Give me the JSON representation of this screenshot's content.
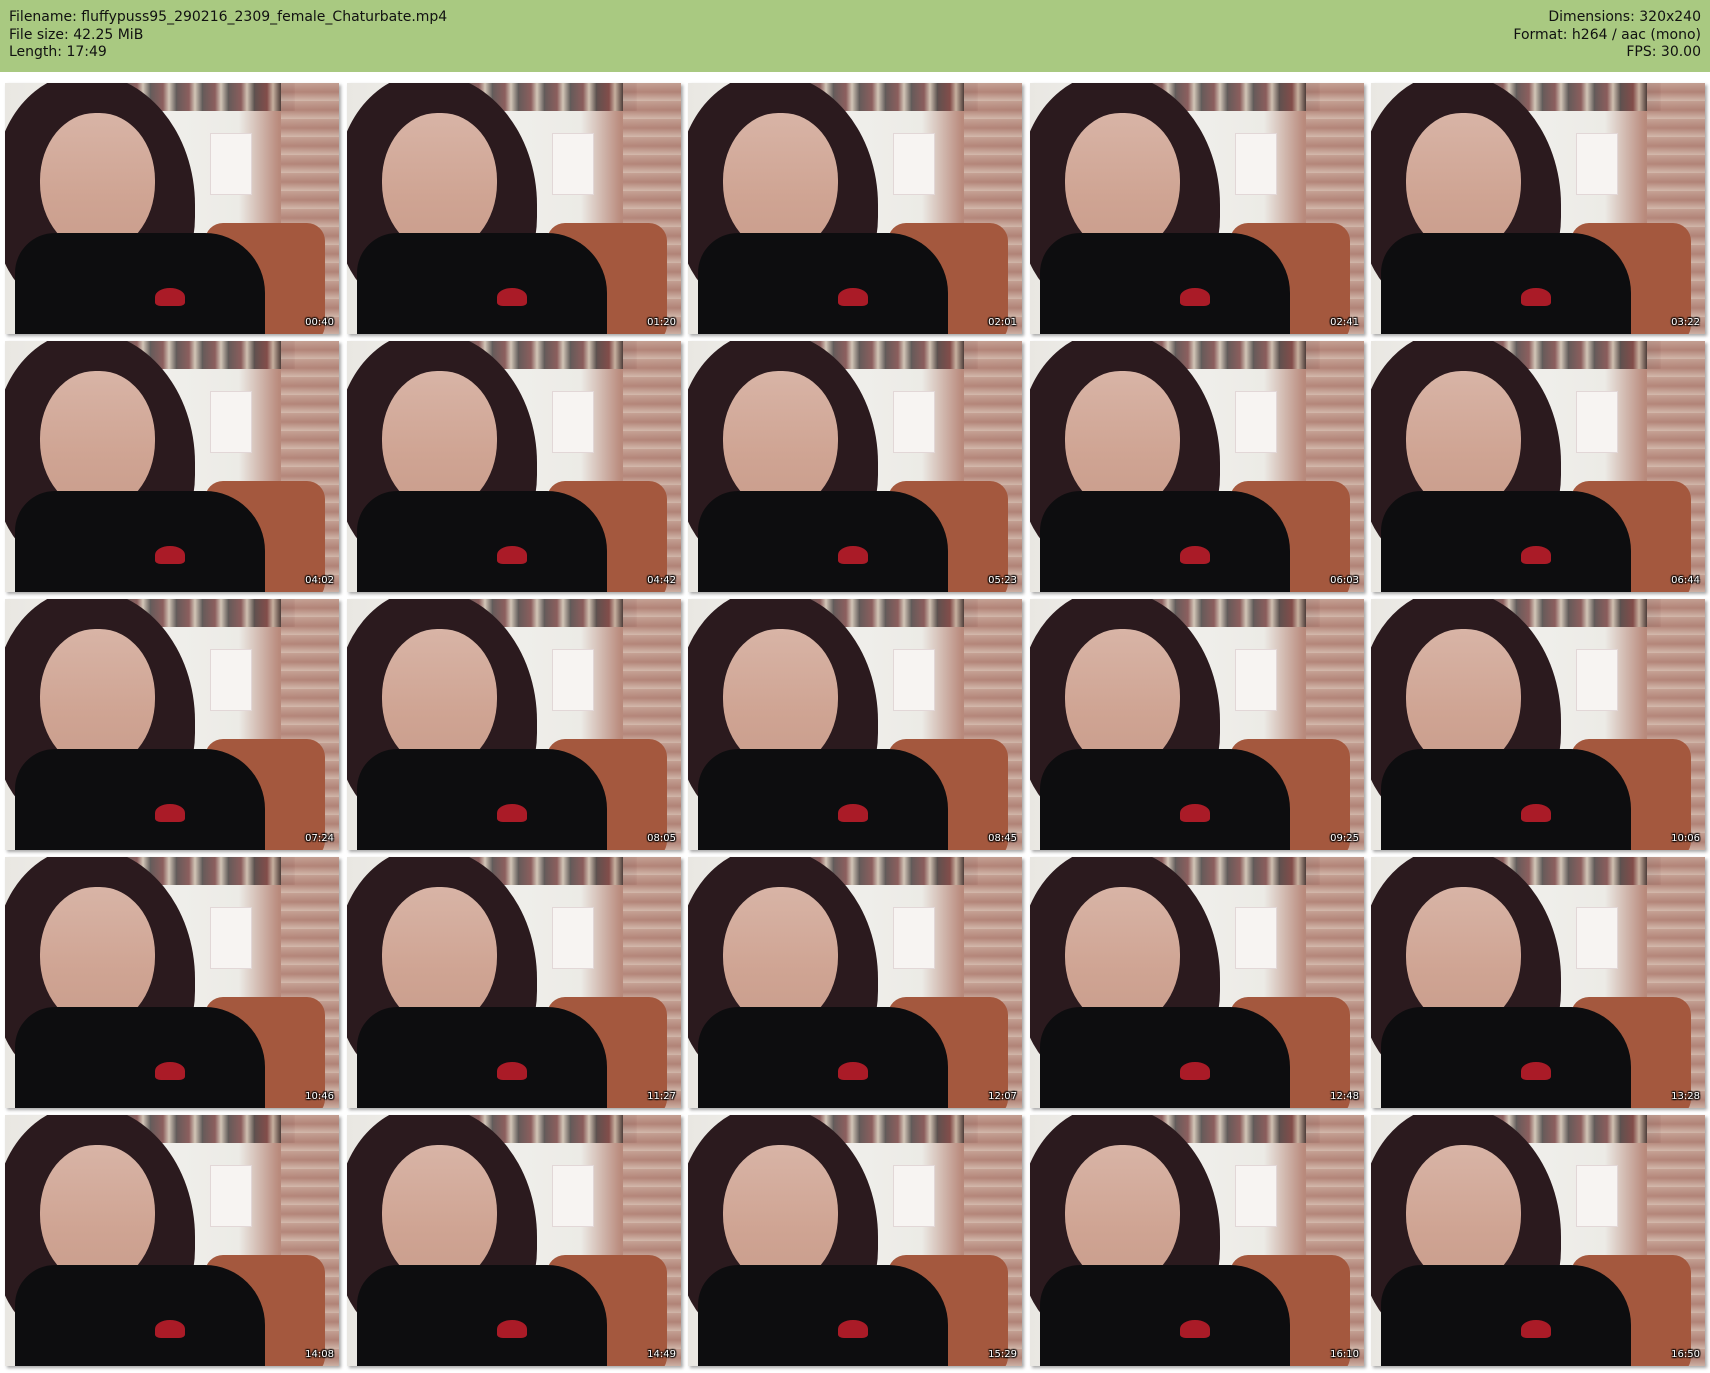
{
  "header": {
    "left": [
      "Filename: fluffypuss95_290216_2309_female_Chaturbate.mp4",
      "File size: 42.25 MiB",
      "Length: 17:49"
    ],
    "right": [
      "Dimensions: 320x240",
      "Format: h264 / aac (mono)",
      "FPS: 30.00"
    ],
    "background": "#a9c981"
  },
  "thumbnails": [
    {
      "time": "00:40"
    },
    {
      "time": "01:20"
    },
    {
      "time": "02:01"
    },
    {
      "time": "02:41"
    },
    {
      "time": "03:22"
    },
    {
      "time": "04:02"
    },
    {
      "time": "04:42"
    },
    {
      "time": "05:23"
    },
    {
      "time": "06:03"
    },
    {
      "time": "06:44"
    },
    {
      "time": "07:24"
    },
    {
      "time": "08:05"
    },
    {
      "time": "08:45"
    },
    {
      "time": "09:25"
    },
    {
      "time": "10:06"
    },
    {
      "time": "10:46"
    },
    {
      "time": "11:27"
    },
    {
      "time": "12:07"
    },
    {
      "time": "12:48"
    },
    {
      "time": "13:28"
    },
    {
      "time": "14:08"
    },
    {
      "time": "14:49"
    },
    {
      "time": "15:29"
    },
    {
      "time": "16:10"
    },
    {
      "time": "16:50"
    }
  ]
}
